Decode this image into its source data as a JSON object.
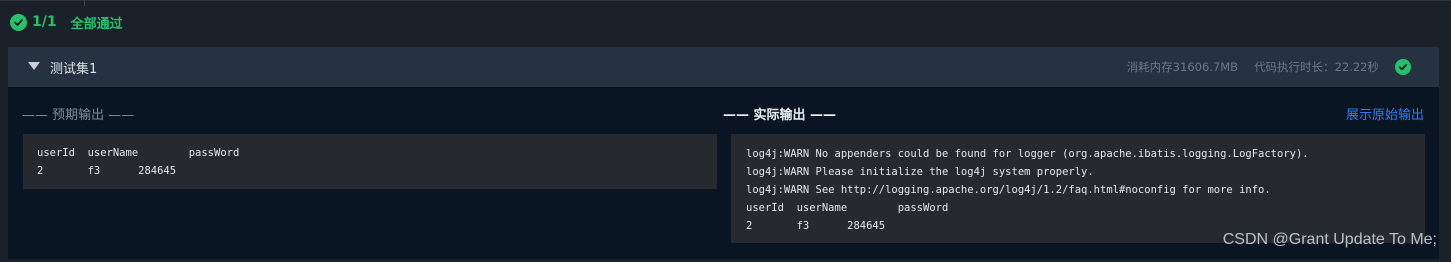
{
  "summary": {
    "count": "1/1",
    "status": "全部通过"
  },
  "testset": {
    "title": "测试集1",
    "memory": "消耗内存31606.7MB",
    "time_label": "代码执行时长：",
    "time_value": "22.22秒"
  },
  "expected": {
    "title": "—— 预期输出 ——",
    "lines": [
      "userId  userName        passWord",
      "2       f3      284645"
    ]
  },
  "actual": {
    "title": "—— 实际输出 ——",
    "raw_link": "展示原始输出",
    "lines": [
      "log4j:WARN No appenders could be found for logger (org.apache.ibatis.logging.LogFactory).",
      "log4j:WARN Please initialize the log4j system properly.",
      "log4j:WARN See http://logging.apache.org/log4j/1.2/faq.html#noconfig for more info.",
      "userId  userName        passWord",
      "2       f3      284645"
    ]
  },
  "watermark": "CSDN @Grant Update To Me;",
  "colors": {
    "success": "#25c26e",
    "link": "#2e7cf6",
    "panel_header": "#243241",
    "panel_body": "#0a1524",
    "output_box": "#262a2e"
  },
  "icons": {
    "summary": "check-circle-icon",
    "toggle": "caret-down-icon",
    "result": "check-circle-icon"
  }
}
